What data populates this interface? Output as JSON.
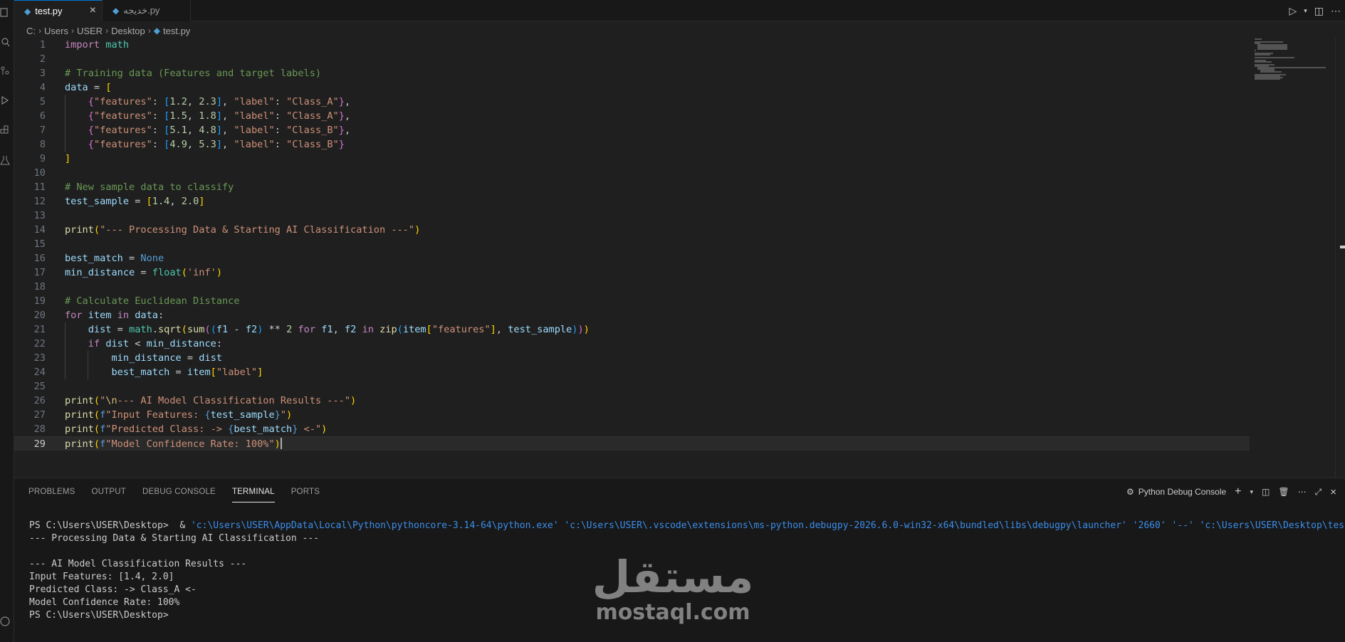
{
  "tabs": [
    {
      "label": "test.py",
      "icon": "python-file-icon",
      "active": true
    },
    {
      "label": "خديجه.py",
      "icon": "python-file-icon",
      "active": false
    }
  ],
  "breadcrumb": [
    "C:",
    "Users",
    "USER",
    "Desktop",
    "test.py"
  ],
  "editor": {
    "line_numbers": [
      "1",
      "2",
      "3",
      "4",
      "5",
      "6",
      "7",
      "8",
      "9",
      "10",
      "11",
      "12",
      "13",
      "14",
      "15",
      "16",
      "17",
      "18",
      "19",
      "20",
      "21",
      "22",
      "23",
      "24",
      "25",
      "26",
      "27",
      "28",
      "29"
    ],
    "current_line": 29
  },
  "panel": {
    "tabs": [
      "PROBLEMS",
      "OUTPUT",
      "DEBUG CONSOLE",
      "TERMINAL",
      "PORTS"
    ],
    "active_tab": "TERMINAL",
    "debug_console_label": "Python Debug Console",
    "terminal_lines": {
      "cmd_prompt": "PS C:\\Users\\USER\\Desktop> ",
      "cmd_amp": " & ",
      "cmd_path": "'c:\\Users\\USER\\AppData\\Local\\Python\\pythoncore-3.14-64\\python.exe' 'c:\\Users\\USER\\.vscode\\extensions\\ms-python.debugpy-2026.6.0-win32-x64\\bundled\\libs\\debugpy\\launcher' '2660' '--' 'c:\\Users\\USER\\Desktop\\test.py'",
      "out1": "--- Processing Data & Starting AI Classification ---",
      "out2": "",
      "out3": "--- AI Model Classification Results ---",
      "out4": "Input Features: [1.4, 2.0]",
      "out5": "Predicted Class: -> Class_A <-",
      "out6": "Model Confidence Rate: 100%",
      "out7": "PS C:\\Users\\USER\\Desktop> "
    }
  },
  "watermark": {
    "arabic": "مستقل",
    "latin": "mostaql.com"
  },
  "colors": {
    "accent": "#0078d4",
    "editor_bg": "#1f1f1f",
    "panel_bg": "#181818"
  }
}
